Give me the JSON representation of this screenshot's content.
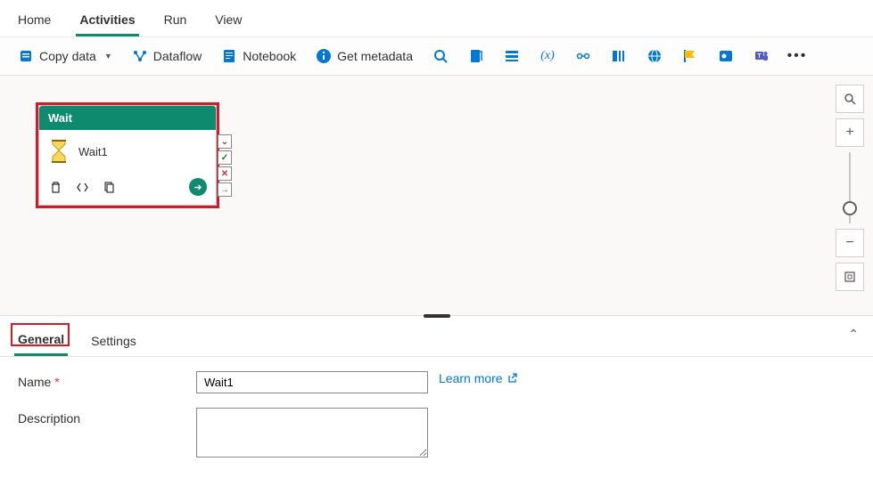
{
  "colors": {
    "accent": "#0e8a6f",
    "highlight": "#d11a2a",
    "link": "#0078d4"
  },
  "topTabs": {
    "home": "Home",
    "activities": "Activities",
    "run": "Run",
    "view": "View",
    "active": "Activities"
  },
  "toolbar": {
    "copyData": "Copy data",
    "dataflow": "Dataflow",
    "notebook": "Notebook",
    "getMetadata": "Get metadata"
  },
  "activity": {
    "type": "Wait",
    "name": "Wait1"
  },
  "propsTabs": {
    "general": "General",
    "settings": "Settings",
    "active": "General"
  },
  "form": {
    "nameLabel": "Name",
    "nameValue": "Wait1",
    "descLabel": "Description",
    "descValue": "",
    "learnMore": "Learn more"
  }
}
